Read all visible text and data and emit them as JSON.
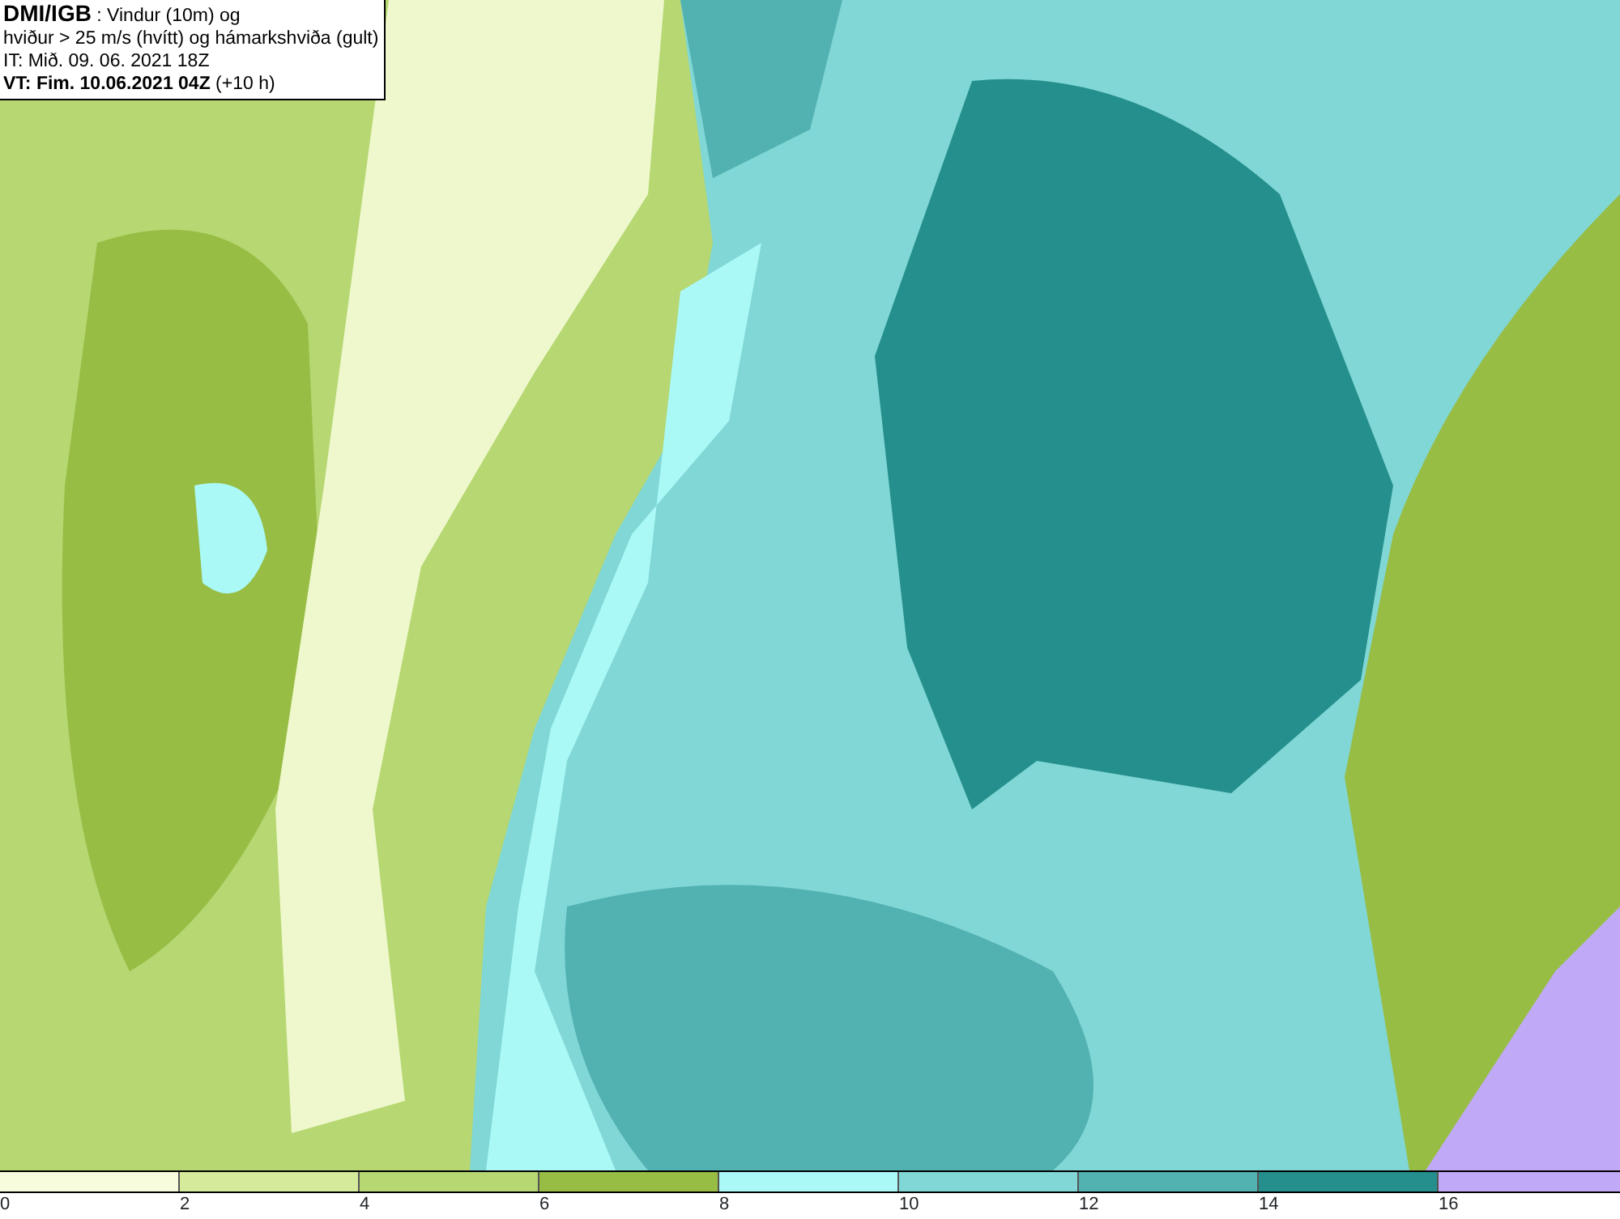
{
  "title_box": {
    "lines": [
      "**DMI/IGB** : Vindur (10m) og",
      "hviður > 25 m/s (hvítt) og hámarkshviða (gult)",
      "IT: Mið. 09. 06. 2021 18Z",
      "**VT: Fim. 10.06.2021 04Z** (+10 h)"
    ]
  },
  "legend": {
    "segments": [
      {
        "color": "#f6fcdc",
        "label": "0"
      },
      {
        "color": "#d3eb9a",
        "label": "2"
      },
      {
        "color": "#b6d772",
        "label": "4"
      },
      {
        "color": "#98bd45",
        "label": "6"
      },
      {
        "color": "#aaf9f6",
        "label": "8"
      },
      {
        "color": "#80d7d5",
        "label": "10"
      },
      {
        "color": "#52b1b1",
        "label": "12"
      },
      {
        "color": "#248f8c",
        "label": "14"
      },
      {
        "color": "#c0a9f6",
        "label": "16"
      }
    ]
  }
}
